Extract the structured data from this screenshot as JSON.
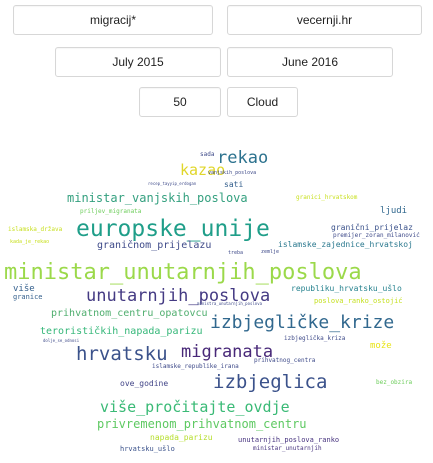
{
  "search": {
    "query_value": "migracij*",
    "source_value": "vecernji.hr",
    "date_from_value": "July 2015",
    "date_to_value": "June 2016",
    "count_value": "50",
    "mode_button_label": "Cloud"
  },
  "word_cloud": {
    "words": [
      {
        "text": "ministar_unutarnjih_poslova",
        "color": "#9bd94a",
        "weight": 100
      },
      {
        "text": "europske_unije",
        "color": "#1f9e89",
        "weight": 88
      },
      {
        "text": "izbjegličke_krize",
        "color": "#31688e",
        "weight": 74
      },
      {
        "text": "izbjeglica",
        "color": "#3b528b",
        "weight": 72
      },
      {
        "text": "unutarnjih_poslova",
        "color": "#443a83",
        "weight": 70
      },
      {
        "text": "hrvatsku",
        "color": "#3b528b",
        "weight": 66
      },
      {
        "text": "migranata",
        "color": "#482878",
        "weight": 64
      },
      {
        "text": "rekao",
        "color": "#2c728e",
        "weight": 60
      },
      {
        "text": "više_pročitajte_ovdje",
        "color": "#3aba76",
        "weight": 57
      },
      {
        "text": "kazao",
        "color": "#e0d62a",
        "weight": 54
      },
      {
        "text": "privremenom_prihvatnom_centru",
        "color": "#5ec962",
        "weight": 45
      },
      {
        "text": "ministar_vanjskih_poslova",
        "color": "#34a07f",
        "weight": 43
      },
      {
        "text": "prihvatnom_centru_opatovcu",
        "color": "#4fae6e",
        "weight": 38
      },
      {
        "text": "graničnom_prijelazu",
        "color": "#3e4a89",
        "weight": 32
      },
      {
        "text": "terorističkih_napada_parizu",
        "color": "#35b779",
        "weight": 32
      },
      {
        "text": "islamske_zajednice_hrvatskoj",
        "color": "#2a788e",
        "weight": 30
      },
      {
        "text": "republiku_hrvatsku_ušlo",
        "color": "#26828e",
        "weight": 30
      },
      {
        "text": "poslova_ranko_ostojić",
        "color": "#c5e021",
        "weight": 28
      },
      {
        "text": "napada_parizu",
        "color": "#b5de2b",
        "weight": 26
      },
      {
        "text": "unutarnjih_poslova_ranko",
        "color": "#46327e",
        "weight": 24
      },
      {
        "text": "ministar_unutarnjih",
        "color": "#46327e",
        "weight": 22
      },
      {
        "text": "hrvatsku_ušlo",
        "color": "#3b528b",
        "weight": 22
      },
      {
        "text": "ove_godine",
        "color": "#414487",
        "weight": 22
      },
      {
        "text": "granični_prijelaz",
        "color": "#3b528b",
        "weight": 24
      },
      {
        "text": "premijer_zoran_milanović",
        "color": "#3e4a89",
        "weight": 20
      },
      {
        "text": "ljudi",
        "color": "#31688e",
        "weight": 24
      },
      {
        "text": "više",
        "color": "#35608d",
        "weight": 24
      },
      {
        "text": "granice",
        "color": "#35608d",
        "weight": 20
      },
      {
        "text": "sati",
        "color": "#35608d",
        "weight": 22
      },
      {
        "text": "islamske_republike_irana",
        "color": "#3e4a89",
        "weight": 20
      },
      {
        "text": "prihvatnog_centra",
        "color": "#3e4a89",
        "weight": 20
      },
      {
        "text": "izbjeglička_kriza",
        "color": "#3e4a89",
        "weight": 20
      },
      {
        "text": "može",
        "color": "#e8e419",
        "weight": 24
      },
      {
        "text": "bez_obzira",
        "color": "#6ccd5a",
        "weight": 18
      },
      {
        "text": "granici_hrvatskom",
        "color": "#c8e020",
        "weight": 20
      },
      {
        "text": "priljev_migranata",
        "color": "#6ccd5a",
        "weight": 18
      },
      {
        "text": "islamska_država",
        "color": "#c8e020",
        "weight": 18
      },
      {
        "text": "vanjskih_poslova",
        "color": "#3e4a89",
        "weight": 16
      },
      {
        "text": "recep_tayyip_erdogan",
        "color": "#3e4a89",
        "weight": 14
      },
      {
        "text": "sada",
        "color": "#3e4a89",
        "weight": 14
      },
      {
        "text": "treba",
        "color": "#3e4a89",
        "weight": 14
      },
      {
        "text": "zemlje",
        "color": "#3e4a89",
        "weight": 14
      },
      {
        "text": "ministra_unutarnjih_poslova",
        "color": "#3e4a89",
        "weight": 14
      },
      {
        "text": "dolje_se_odnosi",
        "color": "#3e4a89",
        "weight": 12
      },
      {
        "text": "kada_je_rekao",
        "color": "#c8e020",
        "weight": 12
      }
    ]
  }
}
